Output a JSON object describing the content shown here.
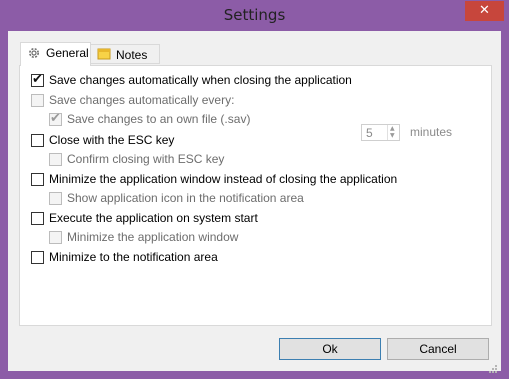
{
  "window": {
    "title": "Settings",
    "close_glyph": "✕",
    "frame_color": "#8c5ca7",
    "close_color": "#c7463c"
  },
  "tabs": [
    {
      "label": "General",
      "icon": "gear-icon",
      "active": true
    },
    {
      "label": "Notes",
      "icon": "notes-icon",
      "active": false
    }
  ],
  "options": {
    "save_on_close": {
      "label": "Save changes automatically when closing the application",
      "checked": true,
      "enabled": true
    },
    "save_every": {
      "label": "Save changes automatically every:",
      "checked": false,
      "enabled": false
    },
    "own_file": {
      "label": "Save changes to an own file (.sav)",
      "checked": true,
      "enabled": false
    },
    "esc_close": {
      "label": "Close with the ESC key",
      "checked": false,
      "enabled": true
    },
    "confirm_esc": {
      "label": "Confirm closing with ESC key",
      "checked": false,
      "enabled": false
    },
    "minimize_instead": {
      "label": "Minimize the application window instead of closing the application",
      "checked": false,
      "enabled": true
    },
    "show_tray_icon": {
      "label": "Show application icon in the notification area",
      "checked": false,
      "enabled": false
    },
    "run_on_start": {
      "label": "Execute the application on system start",
      "checked": false,
      "enabled": true
    },
    "minimize_window": {
      "label": "Minimize the application window",
      "checked": false,
      "enabled": false
    },
    "minimize_tray": {
      "label": "Minimize to the notification area",
      "checked": false,
      "enabled": true
    }
  },
  "interval": {
    "value": "5",
    "unit": "minutes"
  },
  "buttons": {
    "ok": "Ok",
    "cancel": "Cancel"
  }
}
